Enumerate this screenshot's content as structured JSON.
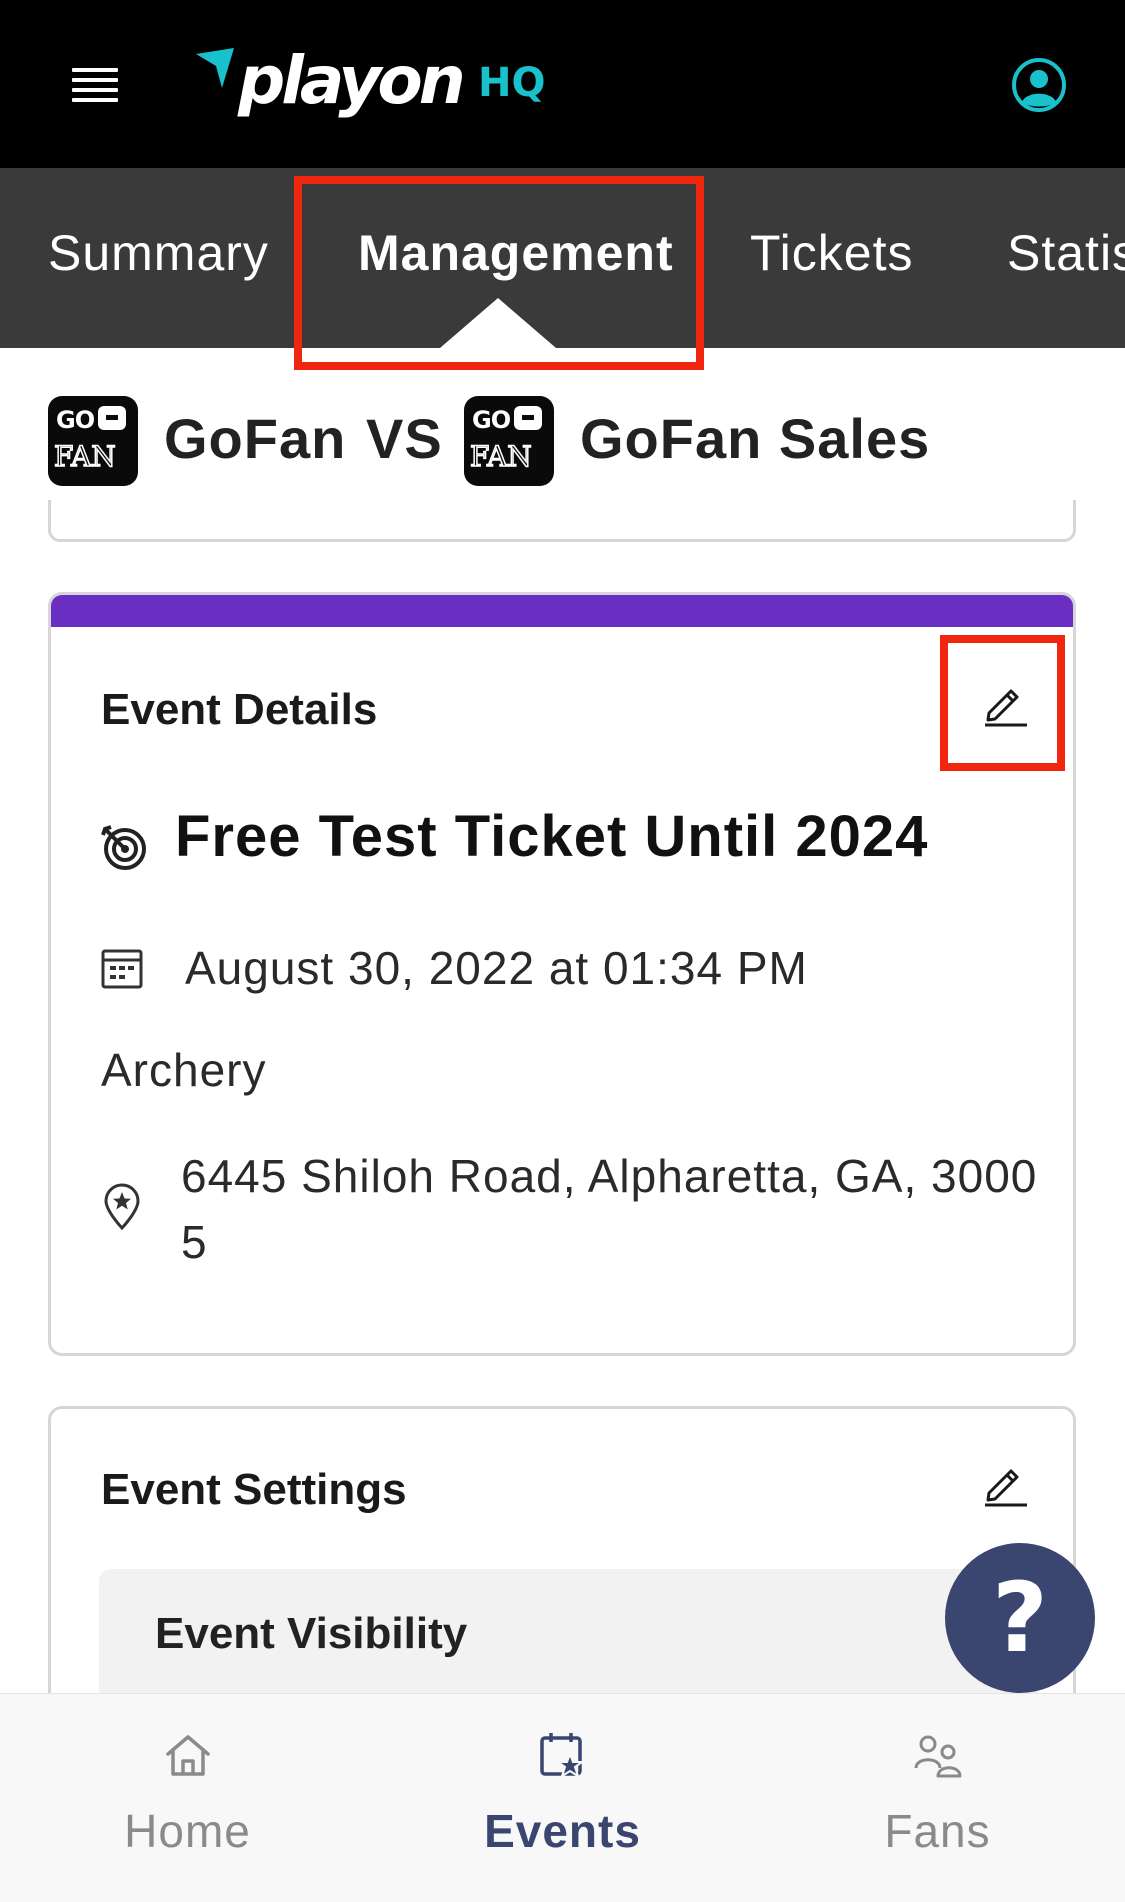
{
  "header": {
    "logo_word": "playon",
    "logo_suffix": "HQ",
    "colors": {
      "background": "#000000",
      "accent": "#18c1cc"
    }
  },
  "tabs": [
    {
      "label": "Summary",
      "active": false
    },
    {
      "label": "Management",
      "active": true
    },
    {
      "label": "Tickets",
      "active": false
    },
    {
      "label": "Statis",
      "active": false
    }
  ],
  "matchup": {
    "home_team": "GoFan",
    "separator": "VS",
    "away_team": "GoFan Sales",
    "team_logo_text": {
      "top": "GO",
      "bottom": "FAN"
    }
  },
  "event_details": {
    "title": "Event Details",
    "event_name": "Free Test Ticket Until 2024",
    "date_time": "August 30, 2022 at 01:34 PM",
    "sport": "Archery",
    "address": "6445 Shiloh Road, Alpharetta, GA, 30005",
    "accent_color": "#6a2ec2"
  },
  "event_settings": {
    "title": "Event Settings",
    "visibility_label": "Event Visibility"
  },
  "help": {
    "label": "?"
  },
  "bottom_nav": [
    {
      "label": "Home",
      "icon": "home-icon",
      "active": false
    },
    {
      "label": "Events",
      "icon": "calendar-star-icon",
      "active": true
    },
    {
      "label": "Fans",
      "icon": "people-icon",
      "active": false
    }
  ],
  "highlight_color": "#f0270e"
}
